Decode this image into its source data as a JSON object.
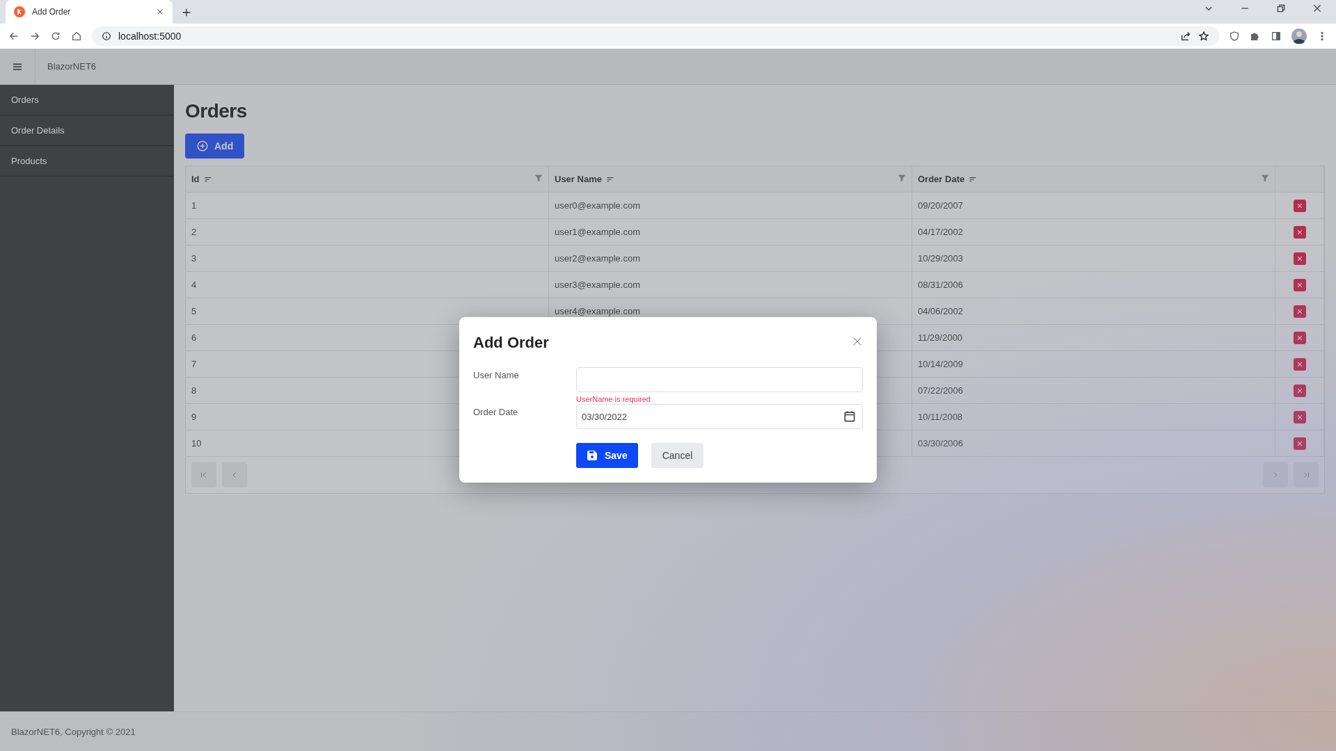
{
  "browser": {
    "tab": {
      "title": "Add Order"
    },
    "address": "localhost:5000"
  },
  "app": {
    "brand": "BlazorNET6"
  },
  "sidebar": {
    "items": [
      {
        "label": "Orders"
      },
      {
        "label": "Order Details"
      },
      {
        "label": "Products"
      }
    ]
  },
  "page": {
    "title": "Orders",
    "add_button": "Add"
  },
  "table": {
    "columns": [
      "Id",
      "User Name",
      "Order Date"
    ],
    "rows": [
      [
        "1",
        "user0@example.com",
        "09/20/2007"
      ],
      [
        "2",
        "user1@example.com",
        "04/17/2002"
      ],
      [
        "3",
        "user2@example.com",
        "10/29/2003"
      ],
      [
        "4",
        "user3@example.com",
        "08/31/2006"
      ],
      [
        "5",
        "user4@example.com",
        "04/06/2002"
      ],
      [
        "6",
        "",
        "11/29/2000"
      ],
      [
        "7",
        "",
        "10/14/2009"
      ],
      [
        "8",
        "",
        "07/22/2006"
      ],
      [
        "9",
        "",
        "10/11/2008"
      ],
      [
        "10",
        "",
        "03/30/2006"
      ]
    ]
  },
  "footer": "BlazorNET6, Copyright © 2021",
  "dialog": {
    "title": "Add Order",
    "fields": [
      {
        "label": "User Name",
        "error": "UserName is required"
      },
      {
        "label": "Order Date",
        "value": "03/30/2022"
      }
    ],
    "save": "Save",
    "cancel": "Cancel"
  }
}
